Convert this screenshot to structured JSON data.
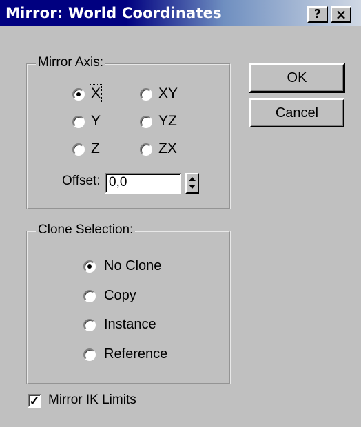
{
  "window": {
    "title": "Mirror: World Coordinates",
    "help_button": "?",
    "close_button": "×"
  },
  "mirror_axis": {
    "label": "Mirror Axis:",
    "options": [
      "X",
      "Y",
      "Z",
      "XY",
      "YZ",
      "ZX"
    ],
    "selected": "X",
    "offset_label": "Offset:",
    "offset_value": "0,0"
  },
  "clone_selection": {
    "label": "Clone Selection:",
    "options": [
      "No Clone",
      "Copy",
      "Instance",
      "Reference"
    ],
    "selected": "No Clone"
  },
  "mirror_ik": {
    "label": "Mirror IK Limits",
    "checked": true,
    "check_mark": "✓"
  },
  "buttons": {
    "ok": "OK",
    "cancel": "Cancel"
  },
  "colors": {
    "title_bar": "#000080",
    "dialog_face": "#c0c0c0"
  }
}
